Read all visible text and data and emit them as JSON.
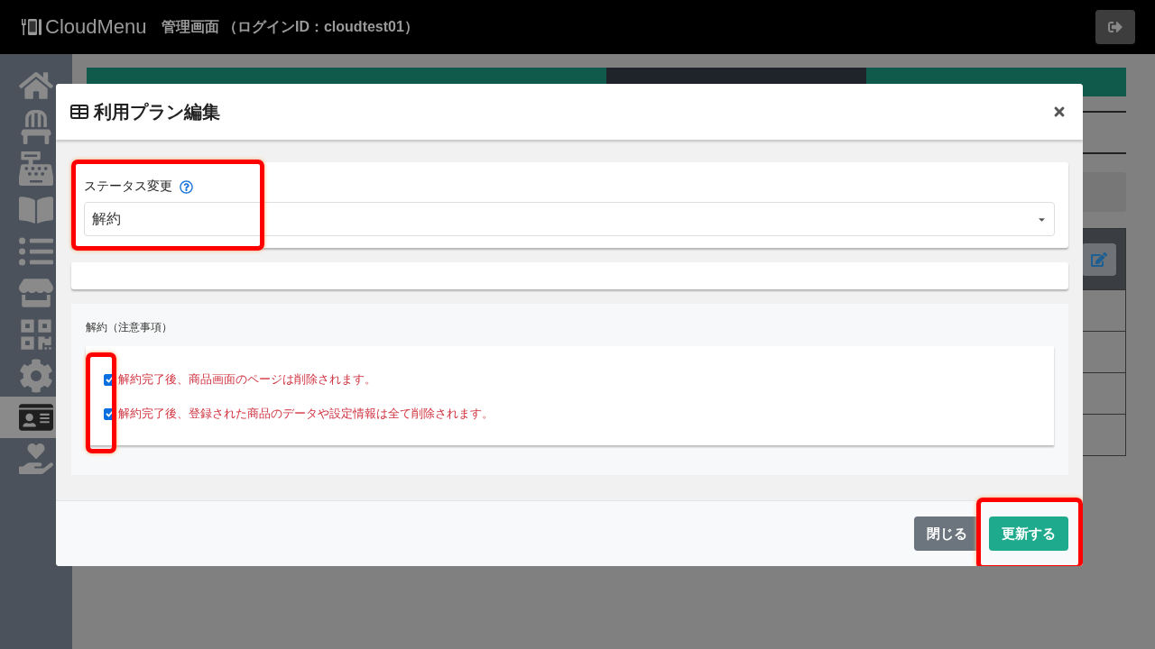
{
  "header": {
    "logo": "CloudMenu",
    "title": "管理画面 （ログインID：cloudtest01）"
  },
  "sidebar": {
    "items": [
      {
        "kind": "home",
        "selected": false
      },
      {
        "kind": "chair",
        "selected": false
      },
      {
        "kind": "register",
        "selected": false
      },
      {
        "kind": "book",
        "selected": false
      },
      {
        "kind": "list",
        "selected": false
      },
      {
        "kind": "store",
        "selected": false
      },
      {
        "kind": "qrcode",
        "selected": false
      },
      {
        "kind": "settings",
        "selected": false
      },
      {
        "kind": "idcard",
        "selected": true
      },
      {
        "kind": "care",
        "selected": false
      }
    ]
  },
  "tabs": [
    {
      "selected": false
    },
    {
      "selected": false
    },
    {
      "selected": true
    },
    {
      "selected": false
    }
  ],
  "modal": {
    "title": "利用プラン編集",
    "status_field": {
      "label": "ステータス変更",
      "value": "解約",
      "highlighted": true
    },
    "notice": {
      "heading": "解約（注意事項）",
      "highlighted": true,
      "items": [
        {
          "text": "解約完了後、商品画面のページは削除されます。",
          "checked": true
        },
        {
          "text": "解約完了後、登録された商品のデータや設定情報は全て削除されます。",
          "checked": true
        }
      ]
    },
    "buttons": [
      {
        "kind": "secondary",
        "label": "閉じる",
        "highlighted": false
      },
      {
        "kind": "primary",
        "label": "更新する",
        "highlighted": true
      }
    ]
  }
}
